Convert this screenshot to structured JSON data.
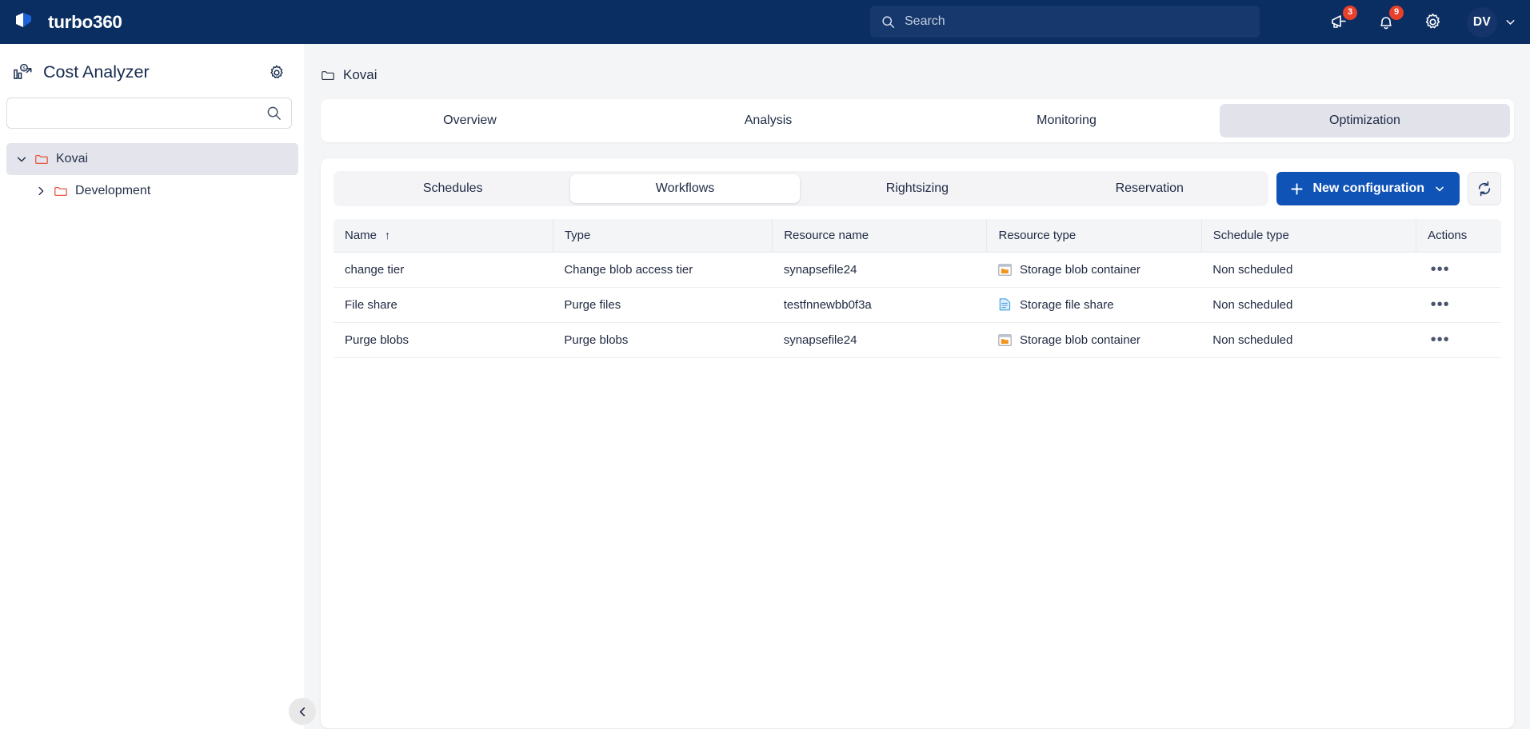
{
  "brand": {
    "name": "turbo360"
  },
  "topbar": {
    "search": {
      "placeholder": "Search",
      "value": ""
    },
    "announcements_badge": "3",
    "notifications_badge": "9",
    "avatar_initials": "DV"
  },
  "sidebar": {
    "title": "Cost Analyzer",
    "search": {
      "placeholder": "",
      "value": ""
    },
    "tree": [
      {
        "label": "Kovai",
        "selected": true,
        "expanded": true,
        "level": 0
      },
      {
        "label": "Development",
        "selected": false,
        "expanded": false,
        "level": 1
      }
    ]
  },
  "main": {
    "breadcrumb": "Kovai",
    "tabs": [
      {
        "label": "Overview",
        "active": false
      },
      {
        "label": "Analysis",
        "active": false
      },
      {
        "label": "Monitoring",
        "active": false
      },
      {
        "label": "Optimization",
        "active": true
      }
    ],
    "subtabs": [
      {
        "label": "Schedules",
        "active": false
      },
      {
        "label": "Workflows",
        "active": true
      },
      {
        "label": "Rightsizing",
        "active": false
      },
      {
        "label": "Reservation",
        "active": false
      }
    ],
    "new_configuration_label": "New configuration",
    "table": {
      "columns": [
        "Name",
        "Type",
        "Resource name",
        "Resource type",
        "Schedule type",
        "Actions"
      ],
      "sorted_column": "Name",
      "sort_direction": "asc",
      "rows": [
        {
          "name": "change tier",
          "type": "Change blob access tier",
          "resource_name": "synapsefile24",
          "resource_type": "Storage blob container",
          "resource_type_icon": "storage-blob-container-icon",
          "schedule_type": "Non scheduled",
          "actions": "•••"
        },
        {
          "name": "File share",
          "type": "Purge files",
          "resource_name": "testfnnewbb0f3a",
          "resource_type": "Storage file share",
          "resource_type_icon": "storage-file-share-icon",
          "schedule_type": "Non scheduled",
          "actions": "•••"
        },
        {
          "name": "Purge blobs",
          "type": "Purge blobs",
          "resource_name": "synapsefile24",
          "resource_type": "Storage blob container",
          "resource_type_icon": "storage-blob-container-icon",
          "schedule_type": "Non scheduled",
          "actions": "•••"
        }
      ]
    }
  },
  "colors": {
    "brand_navy": "#0a2d62",
    "accent_blue": "#1053b6",
    "badge_red": "#e8402a",
    "folder_red": "#e8543f",
    "blob_orange": "#f0951e",
    "fileshare_blue": "#3fa0e0",
    "page_bg": "#f4f5f7"
  }
}
